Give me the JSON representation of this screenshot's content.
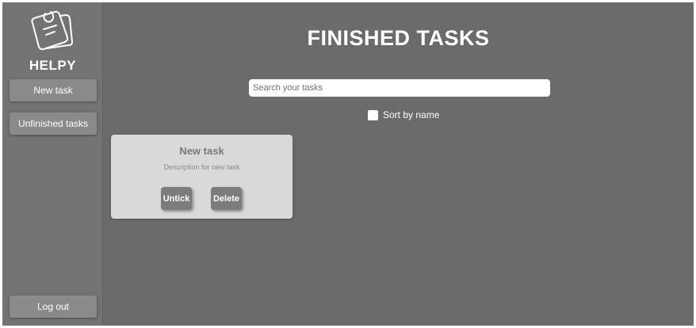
{
  "app": {
    "brand": "HELPY",
    "logo_icon": "sticky-notes-icon"
  },
  "sidebar": {
    "items": [
      {
        "label": "New task"
      },
      {
        "label": "Unfinished tasks"
      }
    ],
    "logout_label": "Log out"
  },
  "main": {
    "title": "FINISHED TASKS",
    "search": {
      "placeholder": "Search your tasks",
      "value": ""
    },
    "sort": {
      "label": "Sort by name",
      "checked": false
    }
  },
  "tasks": [
    {
      "title": "New task",
      "description": "Description for new task",
      "untick_label": "Untick",
      "delete_label": "Delete"
    }
  ],
  "colors": {
    "background": "#6b6b6b",
    "sidebar": "#737373",
    "button": "#8a8a8a",
    "card": "#d9d9d9",
    "card_button": "#7c7c7c"
  }
}
